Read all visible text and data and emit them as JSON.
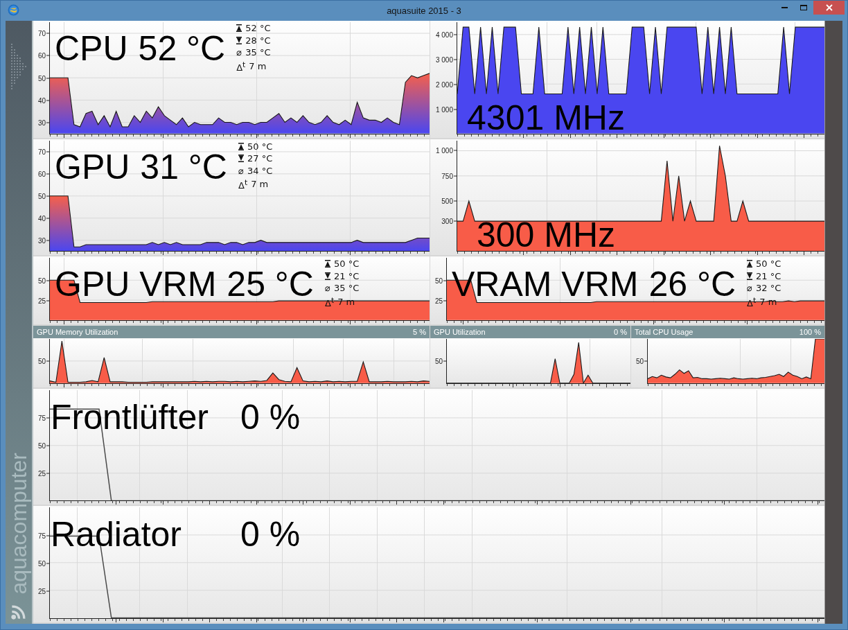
{
  "window": {
    "title": "aquasuite 2015 - 3"
  },
  "sidebar": {
    "logo_text": "aquacomputer"
  },
  "rows": [
    {
      "panels": [
        {
          "kind": "temperature",
          "label": "CPU",
          "value": "52 °C",
          "gradient_fill": true,
          "stats": [
            {
              "kind": "max",
              "value": "52 °C"
            },
            {
              "kind": "min",
              "value": "28 °C"
            },
            {
              "kind": "avg",
              "symbol": "⌀",
              "value": "35 °C"
            },
            {
              "kind": "duration",
              "symbol": "Δ$^{t}$",
              "value": "7 m"
            }
          ],
          "chart_data": {
            "type": "area",
            "grid": true,
            "ylim": [
              25,
              75
            ],
            "yticks": [
              30,
              40,
              50,
              60,
              70
            ],
            "series": [
              {
                "color": "#4a46f0",
                "values": [
                  50,
                  50,
                  50,
                  50,
                  29,
                  28,
                  34,
                  35,
                  29,
                  33,
                  28,
                  35,
                  28,
                  28,
                  33,
                  30,
                  35,
                  32,
                  37,
                  33,
                  31,
                  29,
                  32,
                  28,
                  30,
                  29,
                  29,
                  29,
                  32,
                  30,
                  30,
                  29,
                  30,
                  30,
                  29,
                  30,
                  30,
                  32,
                  34,
                  30,
                  32,
                  30,
                  33,
                  30,
                  29,
                  30,
                  33,
                  30,
                  29,
                  31,
                  29,
                  39,
                  32,
                  31,
                  31,
                  30,
                  32,
                  30,
                  29,
                  48,
                  51,
                  50,
                  51,
                  52
                ]
              }
            ]
          }
        },
        {
          "kind": "clock",
          "value": "4301 MHz",
          "chart_data": {
            "type": "area",
            "grid": true,
            "ylim": [
              0,
              4500
            ],
            "yticks": [
              {
                "value": 1000,
                "label": "1 000"
              },
              {
                "value": 2000,
                "label": "2 000"
              },
              {
                "value": 3000,
                "label": "3 000"
              },
              {
                "value": 4000,
                "label": "4 000"
              }
            ],
            "series": [
              {
                "color": "#4a46f0",
                "values": [
                  1600,
                  4300,
                  4300,
                  1600,
                  4300,
                  1600,
                  4300,
                  1600,
                  4300,
                  4300,
                  4300,
                  1600,
                  1600,
                  1600,
                  4300,
                  1600,
                  1600,
                  1600,
                  1600,
                  4300,
                  1600,
                  4300,
                  1600,
                  4300,
                  1600,
                  4300,
                  1600,
                  1600,
                  1600,
                  1600,
                  4300,
                  4300,
                  4300,
                  1600,
                  4300,
                  1600,
                  4300,
                  4300,
                  4300,
                  4300,
                  4300,
                  4300,
                  1600,
                  4300,
                  1600,
                  4300,
                  1600,
                  4300,
                  1600,
                  1600,
                  1600,
                  1600,
                  1600,
                  1600,
                  1600,
                  1600,
                  4300,
                  1600,
                  4300,
                  4300,
                  4300,
                  4300,
                  4300,
                  4300
                ]
              }
            ]
          }
        }
      ]
    },
    {
      "panels": [
        {
          "kind": "temperature",
          "label": "GPU",
          "value": "31 °C",
          "gradient_fill": true,
          "stats": [
            {
              "kind": "max",
              "value": "50 °C"
            },
            {
              "kind": "min",
              "value": "27 °C"
            },
            {
              "kind": "avg",
              "symbol": "⌀",
              "value": "34 °C"
            },
            {
              "kind": "duration",
              "symbol": "Δ$^{t}$",
              "value": "7 m"
            }
          ],
          "chart_data": {
            "type": "area",
            "grid": true,
            "ylim": [
              25,
              75
            ],
            "yticks": [
              30,
              40,
              50,
              60,
              70
            ],
            "series": [
              {
                "color": "#4a46f0",
                "values": [
                  50,
                  50,
                  50,
                  50,
                  27,
                  27,
                  28,
                  28,
                  28,
                  28,
                  28,
                  28,
                  28,
                  28,
                  28,
                  28,
                  28,
                  29,
                  28,
                  29,
                  28,
                  29,
                  28,
                  28,
                  28,
                  28,
                  29,
                  29,
                  29,
                  28,
                  29,
                  29,
                  28,
                  29,
                  29,
                  30,
                  29,
                  29,
                  29,
                  29,
                  29,
                  29,
                  29,
                  29,
                  29,
                  29,
                  29,
                  29,
                  29,
                  29,
                  29,
                  30,
                  29,
                  29,
                  29,
                  29,
                  29,
                  29,
                  29,
                  29,
                  30,
                  31,
                  31,
                  31
                ]
              }
            ]
          }
        },
        {
          "kind": "clock",
          "value": "300 MHz",
          "chart_data": {
            "type": "area",
            "grid": true,
            "ylim": [
              0,
              1100
            ],
            "yticks": [
              300,
              500,
              750,
              {
                "value": 1000,
                "label": "1 000"
              }
            ],
            "series": [
              {
                "color": "#f85c48",
                "values": [
                  300,
                  300,
                  500,
                  300,
                  300,
                  300,
                  300,
                  300,
                  300,
                  300,
                  300,
                  300,
                  300,
                  300,
                  300,
                  300,
                  300,
                  300,
                  300,
                  300,
                  300,
                  300,
                  300,
                  300,
                  300,
                  300,
                  300,
                  300,
                  300,
                  300,
                  300,
                  300,
                  300,
                  300,
                  300,
                  300,
                  900,
                  300,
                  750,
                  300,
                  500,
                  300,
                  300,
                  300,
                  300,
                  1050,
                  750,
                  300,
                  300,
                  500,
                  300,
                  300,
                  300,
                  300,
                  300,
                  300,
                  300,
                  300,
                  300,
                  300,
                  300,
                  300,
                  300,
                  300
                ]
              }
            ]
          }
        }
      ]
    },
    {
      "panels": [
        {
          "kind": "temperature",
          "label": "GPU VRM",
          "value": "25 °C",
          "stats": [
            {
              "kind": "max",
              "value": "50 °C"
            },
            {
              "kind": "min",
              "value": "21 °C"
            },
            {
              "kind": "avg",
              "symbol": "⌀",
              "value": "35 °C"
            },
            {
              "kind": "duration",
              "symbol": "Δ$^{t}$",
              "value": "7 m"
            }
          ],
          "chart_data": {
            "type": "area",
            "grid": true,
            "ylim": [
              0,
              78
            ],
            "yticks": [
              25,
              50
            ],
            "series": [
              {
                "color": "#f85c48",
                "values": [
                  50,
                  50,
                  50,
                  50,
                  50,
                  22,
                  22,
                  22,
                  22,
                  22,
                  22,
                  22,
                  22,
                  22,
                  22,
                  22,
                  22,
                  23,
                  23,
                  23,
                  23,
                  23,
                  23,
                  23,
                  23,
                  23,
                  23,
                  23,
                  23,
                  23,
                  23,
                  23,
                  23,
                  23,
                  23,
                  23,
                  23,
                  23,
                  24,
                  24,
                  24,
                  24,
                  24,
                  24,
                  24,
                  24,
                  24,
                  24,
                  24,
                  24,
                  24,
                  24,
                  24,
                  24,
                  24,
                  24,
                  24,
                  24,
                  24,
                  24,
                  24,
                  24,
                  24,
                  24
                ]
              }
            ]
          }
        },
        {
          "kind": "temperature",
          "label": "VRAM VRM",
          "value": "26 °C",
          "stats": [
            {
              "kind": "max",
              "value": "50 °C"
            },
            {
              "kind": "min",
              "value": "21 °C"
            },
            {
              "kind": "avg",
              "symbol": "⌀",
              "value": "32 °C"
            },
            {
              "kind": "duration",
              "symbol": "Δ$^{t}$",
              "value": "7 m"
            }
          ],
          "chart_data": {
            "type": "area",
            "grid": true,
            "ylim": [
              0,
              78
            ],
            "yticks": [
              25,
              50
            ],
            "series": [
              {
                "color": "#f85c48",
                "values": [
                  50,
                  50,
                  50,
                  50,
                  50,
                  22,
                  22,
                  22,
                  22,
                  22,
                  22,
                  22,
                  22,
                  22,
                  22,
                  22,
                  22,
                  22,
                  22,
                  22,
                  22,
                  22,
                  22,
                  22,
                  22,
                  23,
                  23,
                  23,
                  23,
                  23,
                  23,
                  23,
                  23,
                  23,
                  23,
                  23,
                  23,
                  23,
                  23,
                  23,
                  23,
                  23,
                  23,
                  23,
                  23,
                  23,
                  23,
                  23,
                  23,
                  23,
                  23,
                  23,
                  23,
                  23,
                  24,
                  23,
                  23,
                  24,
                  23,
                  24,
                  24,
                  24,
                  24,
                  24
                ]
              }
            ]
          }
        }
      ]
    },
    {
      "panels": [
        {
          "kind": "utilization",
          "label": "GPU Memory Utilization",
          "value": "5 %",
          "chart_data": {
            "type": "area",
            "grid": true,
            "ylim": [
              0,
              100
            ],
            "yticks": [
              50
            ],
            "series": [
              {
                "color": "#f85c48",
                "values": [
                  5,
                  2,
                  95,
                  2,
                  2,
                  2,
                  3,
                  6,
                  3,
                  58,
                  3,
                  3,
                  3,
                  2,
                  2,
                  2,
                  2,
                  3,
                  3,
                  3,
                  3,
                  3,
                  3,
                  3,
                  4,
                  3,
                  4,
                  3,
                  4,
                  4,
                  3,
                  4,
                  3,
                  4,
                  5,
                  4,
                  6,
                  23,
                  8,
                  4,
                  3,
                  35,
                  5,
                  3,
                  4,
                  3,
                  5,
                  3,
                  4,
                  3,
                  4,
                  4,
                  48,
                  3,
                  3,
                  3,
                  4,
                  3,
                  3,
                  3,
                  4,
                  3,
                  5,
                  4
                ]
              }
            ]
          }
        },
        {
          "kind": "utilization",
          "label": "GPU Utilization",
          "value": "0 %",
          "y_axis_label": "50"
        },
        {
          "kind": "utilization",
          "label": "Total CPU Usage",
          "value": "100 %",
          "y_axis_label": "50"
        }
      ]
    },
    {
      "panels": [
        {
          "kind": "fan",
          "label": "Frontlüfter",
          "value": "0 %",
          "chart_data": {
            "type": "line",
            "grid": true,
            "ylim": [
              0,
              100
            ],
            "yticks": [
              25,
              50,
              75
            ],
            "series": [
              {
                "color": "#4a4a4a",
                "values": [
                  83,
                  83,
                  83,
                  83,
                  83,
                  0,
                  0,
                  0,
                  0,
                  0,
                  0,
                  0,
                  0,
                  0,
                  0,
                  0,
                  0,
                  0,
                  0,
                  0,
                  0,
                  0,
                  0,
                  0,
                  0,
                  0,
                  0,
                  0,
                  0,
                  0,
                  0,
                  0,
                  0,
                  0,
                  0,
                  0,
                  0,
                  0,
                  0,
                  0,
                  0,
                  0,
                  0,
                  0,
                  0,
                  0,
                  0,
                  0,
                  0,
                  0,
                  0,
                  0,
                  0,
                  0,
                  0,
                  0,
                  0,
                  0,
                  0,
                  0,
                  0,
                  0,
                  0,
                  0
                ]
              }
            ]
          }
        }
      ]
    },
    {
      "panels": [
        {
          "kind": "fan",
          "label": "Radiator",
          "value": "0 %",
          "chart_data": {
            "type": "line",
            "grid": true,
            "ylim": [
              0,
              100
            ],
            "yticks": [
              25,
              50,
              75
            ],
            "series": [
              {
                "color": "#4a4a4a",
                "values": [
                  74,
                  74,
                  74,
                  74,
                  74,
                  0,
                  0,
                  0,
                  0,
                  0,
                  0,
                  0,
                  0,
                  0,
                  0,
                  0,
                  0,
                  0,
                  0,
                  0,
                  0,
                  0,
                  0,
                  0,
                  0,
                  0,
                  0,
                  0,
                  0,
                  0,
                  0,
                  0,
                  0,
                  0,
                  0,
                  0,
                  0,
                  0,
                  0,
                  0,
                  0,
                  0,
                  0,
                  0,
                  0,
                  0,
                  0,
                  0,
                  0,
                  0,
                  0,
                  0,
                  0,
                  0,
                  0,
                  0,
                  0,
                  0,
                  0,
                  0,
                  0,
                  0,
                  0,
                  0
                ]
              }
            ]
          }
        }
      ]
    }
  ]
}
